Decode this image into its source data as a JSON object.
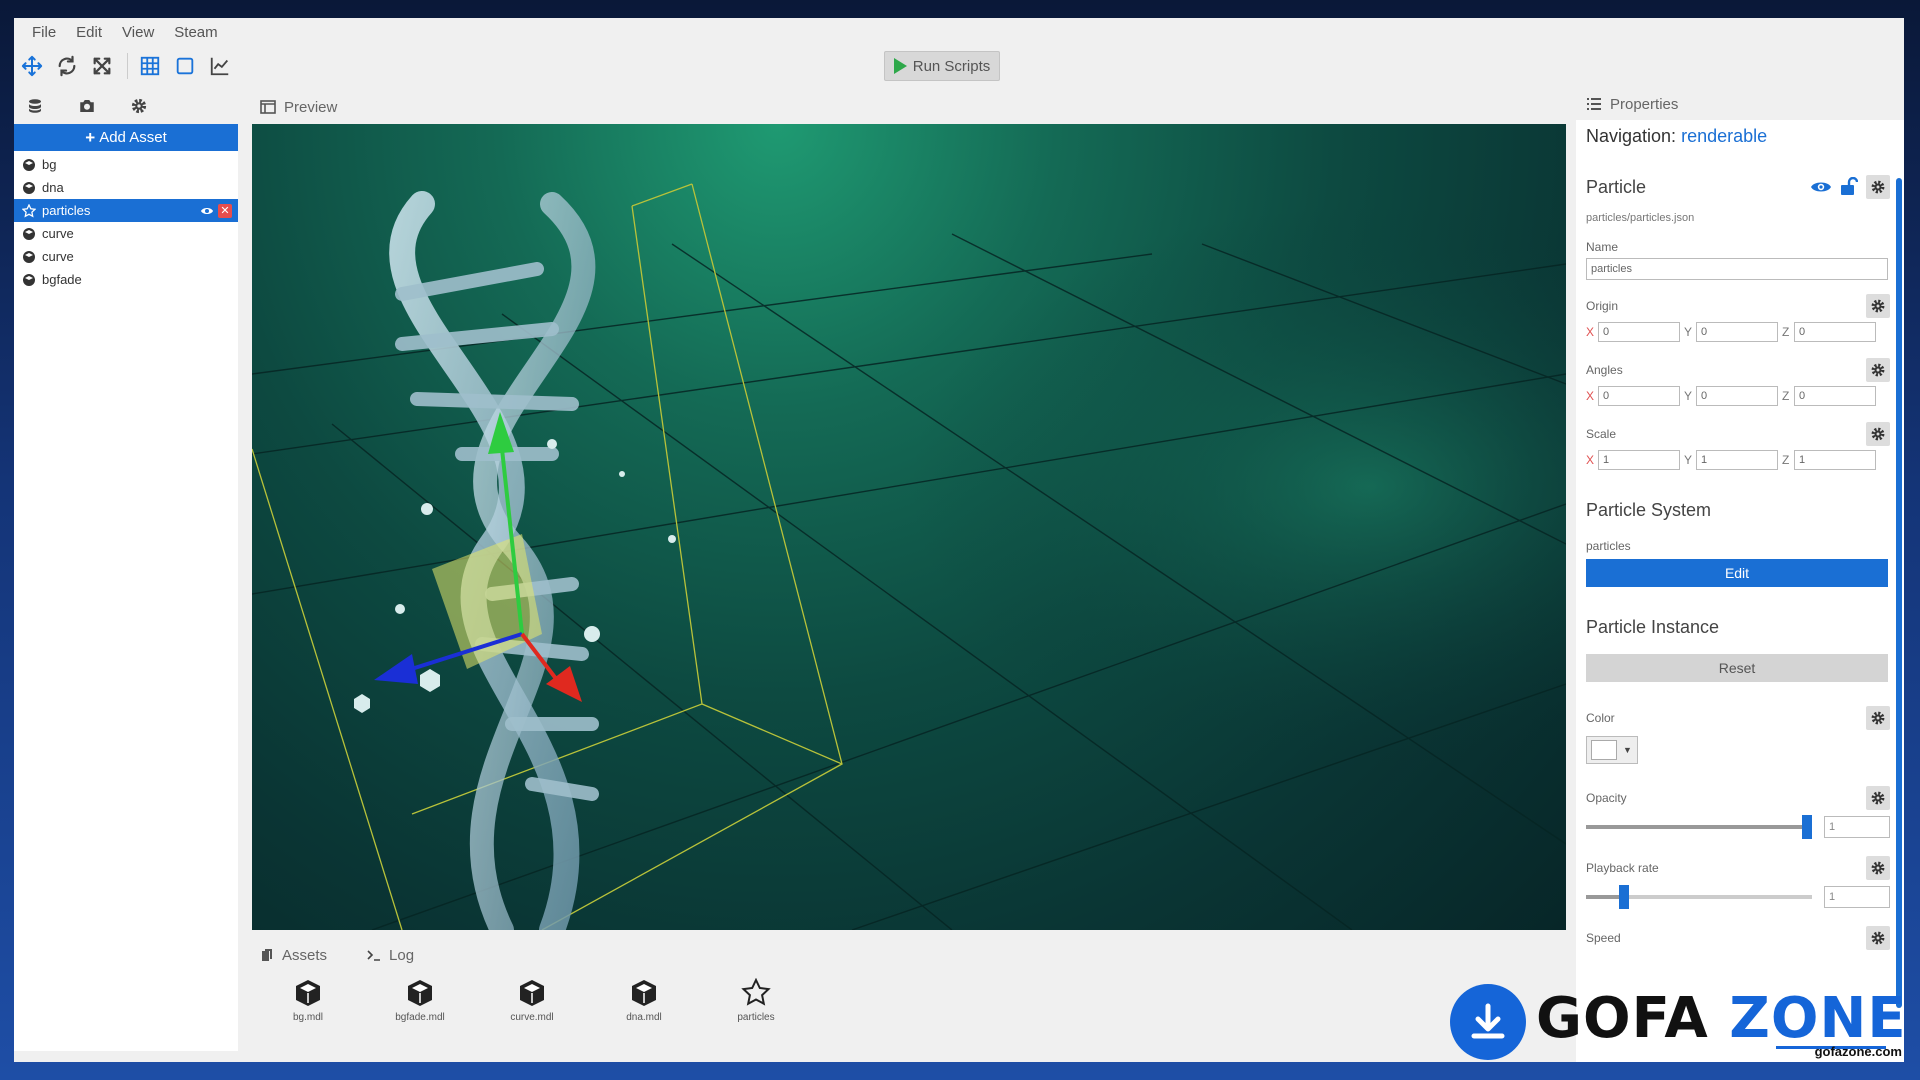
{
  "menu": [
    "File",
    "Edit",
    "View",
    "Steam"
  ],
  "toolbar": {
    "tools": [
      "move-icon",
      "rotate-icon",
      "scale-icon",
      "grid-icon",
      "box-icon",
      "graph-icon"
    ],
    "run_label": "Run Scripts"
  },
  "left": {
    "tabs": [
      "layers-icon",
      "camera-icon",
      "gear-icon"
    ],
    "add_asset_label": "Add Asset",
    "assets": [
      {
        "label": "bg",
        "icon": "model-icon",
        "selected": false
      },
      {
        "label": "dna",
        "icon": "model-icon",
        "selected": false
      },
      {
        "label": "particles",
        "icon": "star-icon",
        "selected": true
      },
      {
        "label": "curve",
        "icon": "model-icon",
        "selected": false
      },
      {
        "label": "curve",
        "icon": "model-icon",
        "selected": false
      },
      {
        "label": "bgfade",
        "icon": "model-icon",
        "selected": false
      }
    ]
  },
  "center": {
    "preview_label": "Preview",
    "bottom_tabs": {
      "assets": "Assets",
      "log": "Log"
    },
    "tiles": [
      {
        "label": "bg.mdl",
        "icon": "cube-icon"
      },
      {
        "label": "bgfade.mdl",
        "icon": "cube-icon"
      },
      {
        "label": "curve.mdl",
        "icon": "cube-icon"
      },
      {
        "label": "dna.mdl",
        "icon": "cube-icon"
      },
      {
        "label": "particles",
        "icon": "star-icon"
      }
    ]
  },
  "properties": {
    "tab_label": "Properties",
    "nav_prefix": "Navigation:",
    "nav_link": "renderable",
    "particle_title": "Particle",
    "path": "particles/particles.json",
    "name_label": "Name",
    "name_value": "particles",
    "origin_label": "Origin",
    "origin": {
      "x": "0",
      "y": "0",
      "z": "0"
    },
    "angles_label": "Angles",
    "angles": {
      "x": "0",
      "y": "0",
      "z": "0"
    },
    "scale_label": "Scale",
    "scale": {
      "x": "1",
      "y": "1",
      "z": "1"
    },
    "axis": {
      "x": "X",
      "y": "Y",
      "z": "Z"
    },
    "system_title": "Particle System",
    "system_value": "particles",
    "edit_label": "Edit",
    "instance_title": "Particle Instance",
    "reset_label": "Reset",
    "color_label": "Color",
    "color_value": "#ffffff",
    "opacity_label": "Opacity",
    "opacity_value": "1",
    "opacity_fraction": 0.98,
    "playback_label": "Playback rate",
    "playback_value": "1",
    "playback_fraction": 0.17,
    "speed_label": "Speed"
  },
  "watermark": {
    "brand_a": "GOFA",
    "brand_b": "ZONE",
    "url": "gofazone.com"
  },
  "colors": {
    "accent": "#1a6fd4",
    "run_green": "#2ea84a",
    "close_red": "#e84d4d"
  }
}
